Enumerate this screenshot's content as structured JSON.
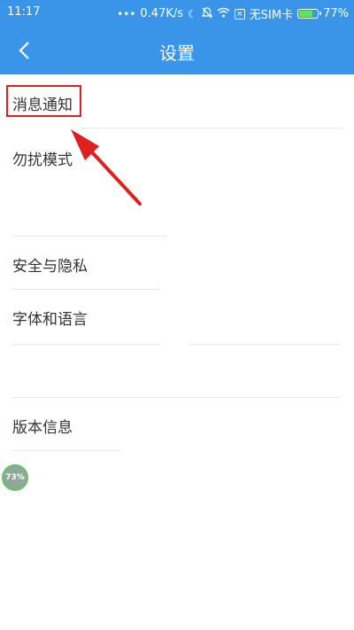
{
  "status_bar": {
    "time": "11:17",
    "net_speed": "0.47K/s",
    "sim": "无SIM卡",
    "battery": "77%",
    "battery_level": 0.77,
    "icons": [
      "more-dots-icon",
      "moon-icon",
      "bell-off-icon",
      "wifi-icon",
      "sim-x-icon",
      "battery-icon"
    ]
  },
  "header": {
    "title": "设置",
    "back_icon": "chevron-left-icon"
  },
  "settings": {
    "items": [
      {
        "label": "消息通知"
      },
      {
        "label": "勿扰模式"
      },
      {
        "label": "安全与隐私"
      },
      {
        "label": "字体和语言"
      },
      {
        "label": "版本信息"
      }
    ]
  },
  "overlay": {
    "badge_text": "73%",
    "highlight_color": "#e02020",
    "accent_color": "#3a95e8"
  }
}
